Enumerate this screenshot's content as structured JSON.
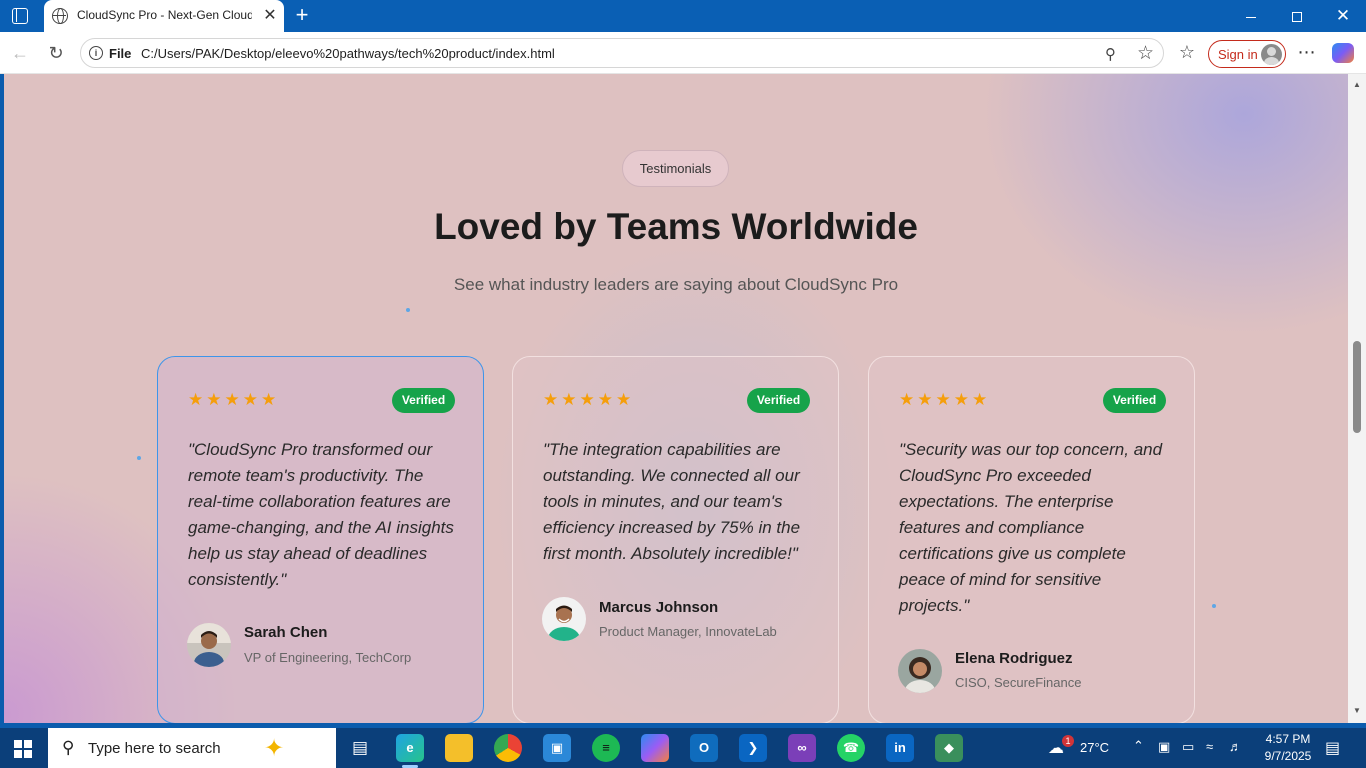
{
  "browser": {
    "tab_title": "CloudSync Pro - Next-Gen Cloud",
    "tab_close": "✕",
    "new_tab": "+",
    "address_label": "File",
    "url": "C:/Users/PAK/Desktop/eleevo%20pathways/tech%20product/index.html",
    "sign_in": "Sign in",
    "window_controls": {
      "close": "✕"
    }
  },
  "section": {
    "badge": "Testimonials",
    "title": "Loved by Teams Worldwide",
    "subtitle": "See what industry leaders are saying about CloudSync Pro"
  },
  "testimonials": [
    {
      "stars": "★★★★★",
      "rating": 5,
      "verified": "Verified",
      "quote": "\"CloudSync Pro transformed our remote team's productivity. The real-time collaboration features are game-changing, and the AI insights help us stay ahead of deadlines consistently.\"",
      "name": "Sarah Chen",
      "role": "VP of Engineering, TechCorp"
    },
    {
      "stars": "★★★★★",
      "rating": 5,
      "verified": "Verified",
      "quote": "\"The integration capabilities are outstanding. We connected all our tools in minutes, and our team's efficiency increased by 75% in the first month. Absolutely incredible!\"",
      "name": "Marcus Johnson",
      "role": "Product Manager, InnovateLab"
    },
    {
      "stars": "★★★★★",
      "rating": 5,
      "verified": "Verified",
      "quote": "\"Security was our top concern, and CloudSync Pro exceeded expectations. The enterprise features and compliance certifications give us complete peace of mind for sensitive projects.\"",
      "name": "Elena Rodriguez",
      "role": "CISO, SecureFinance"
    }
  ],
  "taskbar": {
    "search_placeholder": "Type here to search",
    "weather": "27°C",
    "weather_badge": "1",
    "time": "4:57 PM",
    "date": "9/7/2025",
    "apps": [
      "task-view",
      "edge",
      "file-explorer",
      "chrome",
      "microsoft-store",
      "spotify",
      "copilot",
      "outlook",
      "vscode",
      "visual-studio",
      "whatsapp",
      "linkedin",
      "git"
    ]
  },
  "colors": {
    "accent_border": "#3d95ea",
    "verified_green": "#16a34a",
    "star_orange": "#f59e0b",
    "signin_red": "#c42b1c"
  }
}
